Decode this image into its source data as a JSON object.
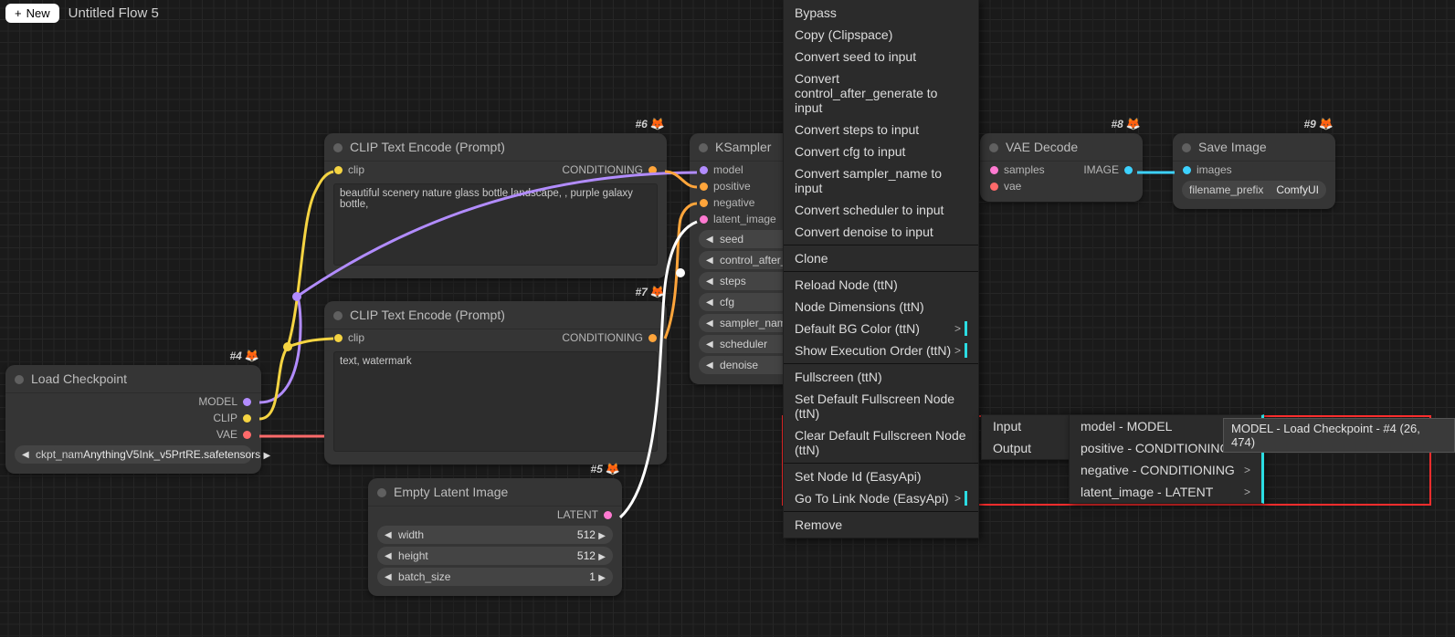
{
  "topbar": {
    "new_button": "New",
    "plus": "+",
    "flow_title": "Untitled Flow 5"
  },
  "nodes": {
    "load_checkpoint": {
      "tag": "#4",
      "title": "Load Checkpoint",
      "outputs": [
        "MODEL",
        "CLIP",
        "VAE"
      ],
      "widget_label": "ckpt_nam",
      "widget_value": "AnythingV5Ink_v5PrtRE.safetensors"
    },
    "clip_pos": {
      "tag": "#6",
      "title": "CLIP Text Encode (Prompt)",
      "input": "clip",
      "output": "CONDITIONING",
      "text": "beautiful scenery nature glass bottle landscape, , purple galaxy bottle,"
    },
    "clip_neg": {
      "tag": "#7",
      "title": "CLIP Text Encode (Prompt)",
      "input": "clip",
      "output": "CONDITIONING",
      "text": "text, watermark"
    },
    "empty_latent": {
      "tag": "#5",
      "title": "Empty Latent Image",
      "output": "LATENT",
      "widgets": [
        {
          "label": "width",
          "value": "512"
        },
        {
          "label": "height",
          "value": "512"
        },
        {
          "label": "batch_size",
          "value": "1"
        }
      ]
    },
    "ksampler": {
      "title": "KSampler",
      "inputs": [
        "model",
        "positive",
        "negative",
        "latent_image"
      ],
      "widgets": [
        "seed",
        "control_after_ge",
        "steps",
        "cfg",
        "sampler_name",
        "scheduler",
        "denoise"
      ]
    },
    "vae_decode": {
      "tag": "#8",
      "title": "VAE Decode",
      "inputs": [
        "samples",
        "vae"
      ],
      "output": "IMAGE"
    },
    "save_image": {
      "tag": "#9",
      "title": "Save Image",
      "input": "images",
      "widget_label": "filename_prefix",
      "widget_value": "ComfyUI"
    }
  },
  "context_menu": {
    "items": [
      {
        "label": "Bypass"
      },
      {
        "label": "Copy (Clipspace)"
      },
      {
        "label": "Convert seed to input"
      },
      {
        "label": "Convert control_after_generate to input"
      },
      {
        "label": "Convert steps to input"
      },
      {
        "label": "Convert cfg to input"
      },
      {
        "label": "Convert sampler_name to input"
      },
      {
        "label": "Convert scheduler to input"
      },
      {
        "label": "Convert denoise to input"
      },
      {
        "sep": true
      },
      {
        "label": "Clone"
      },
      {
        "sep": true
      },
      {
        "label": "Reload Node (ttN)"
      },
      {
        "label": "Node Dimensions (ttN)"
      },
      {
        "label": "Default BG Color (ttN)",
        "submenu": true
      },
      {
        "label": "Show Execution Order (ttN)",
        "submenu": true
      },
      {
        "sep": true
      },
      {
        "label": "Fullscreen (ttN)"
      },
      {
        "label": "Set Default Fullscreen Node (ttN)"
      },
      {
        "label": "Clear Default Fullscreen Node (ttN)"
      },
      {
        "sep": true
      },
      {
        "label": "Set Node Id (EasyApi)"
      },
      {
        "label": "Go To Link Node (EasyApi)",
        "submenu": true
      },
      {
        "sep": true
      },
      {
        "label": "Remove"
      }
    ]
  },
  "submenu1": {
    "items": [
      {
        "label": "Input",
        "submenu": true
      },
      {
        "label": "Output",
        "submenu": true
      }
    ]
  },
  "submenu2": {
    "items": [
      {
        "label": "model - MODEL",
        "submenu": true
      },
      {
        "label": "positive - CONDITIONING",
        "submenu": true
      },
      {
        "label": "negative - CONDITIONING",
        "submenu": true
      },
      {
        "label": "latent_image - LATENT",
        "submenu": true
      }
    ]
  },
  "final_target": "MODEL - Load Checkpoint - #4 (26, 474)"
}
